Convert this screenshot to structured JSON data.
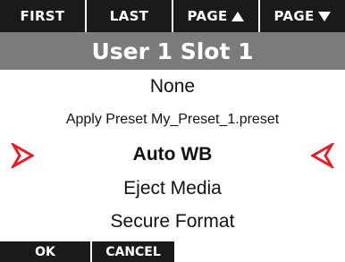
{
  "nav": {
    "first_label": "FIRST",
    "last_label": "LAST",
    "page_up_label": "PAGE",
    "page_down_label": "PAGE"
  },
  "title": "User 1 Slot 1",
  "options": [
    "None",
    "Apply Preset My_Preset_1.preset",
    "Auto WB",
    "Eject Media",
    "Secure Format"
  ],
  "selected_index": 2,
  "selector_color": "#e0202a",
  "bottom": {
    "ok_label": "OK",
    "cancel_label": "CANCEL"
  }
}
